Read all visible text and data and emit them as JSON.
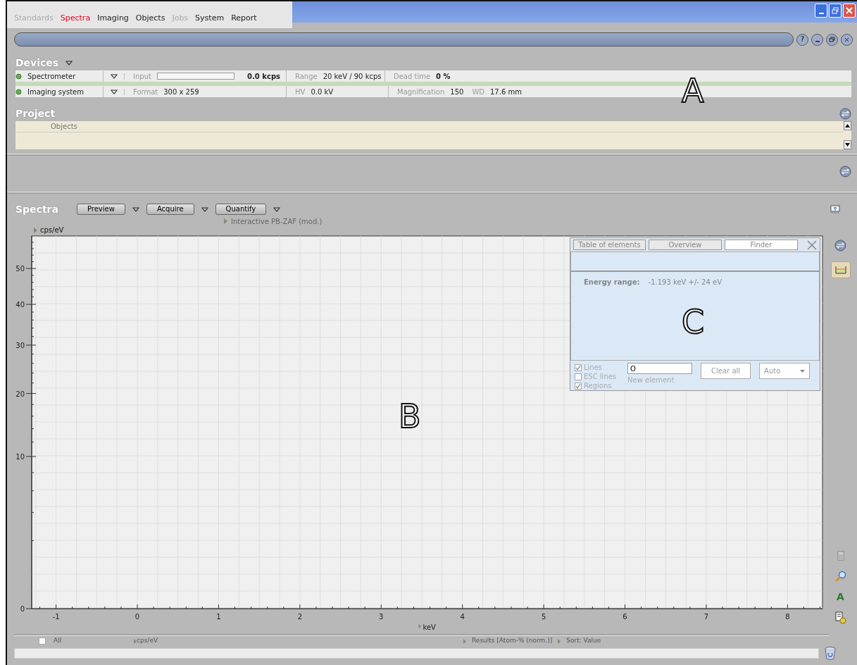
{
  "menu_tabs": [
    {
      "label": "Standards",
      "selected": false,
      "disabled": true
    },
    {
      "label": "Spectra",
      "selected": true,
      "disabled": false
    },
    {
      "label": "Imaging",
      "selected": false,
      "disabled": false
    },
    {
      "label": "Objects",
      "selected": false,
      "disabled": false
    },
    {
      "label": "Jobs",
      "selected": false,
      "disabled": true
    },
    {
      "label": "System",
      "selected": false,
      "disabled": false
    },
    {
      "label": "Report",
      "selected": false,
      "disabled": false
    }
  ],
  "panel_buttons": {
    "help": "?"
  },
  "devices": {
    "title": "Devices",
    "rows": [
      {
        "name": "Spectrometer",
        "fields": [
          {
            "kind": "meter",
            "label": "Input",
            "value": "0.0 kcps",
            "bold": true
          },
          {
            "kind": "text",
            "label": "Range",
            "value": "20 keV / 90 kcps",
            "bold": false
          },
          {
            "kind": "text",
            "label": "Dead time",
            "value": "0 %",
            "bold": true
          }
        ]
      },
      {
        "name": "Imaging system",
        "fields": [
          {
            "kind": "text",
            "label": "Format",
            "value": "300 x 259",
            "bold": false
          },
          {
            "kind": "text",
            "label": "HV",
            "value": "0.0 kV",
            "bold": false
          },
          {
            "kind": "text",
            "label": "Magnification",
            "value": "150",
            "bold": false
          },
          {
            "kind": "text",
            "label": "WD",
            "value": "17.6 mm",
            "bold": false
          }
        ]
      }
    ]
  },
  "project": {
    "title": "Project",
    "columns": [
      "Objects"
    ]
  },
  "spectra": {
    "title": "Spectra",
    "buttons": [
      "Preview",
      "Acquire",
      "Quantify"
    ],
    "method": "Interactive PB-ZAF (mod.)",
    "plot": {
      "xlabel": "keV",
      "ylabel": "cps/eV",
      "x_tick_labels": [
        "-1",
        "0",
        "1",
        "2",
        "3",
        "4",
        "5",
        "6",
        "7",
        "8"
      ],
      "y_tick_labels": [
        "50",
        "40",
        "30",
        "20",
        "10",
        "0"
      ]
    },
    "finder": {
      "tabs": [
        {
          "label": "Table of elements",
          "selected": false
        },
        {
          "label": "Overview",
          "selected": false
        },
        {
          "label": "Finder",
          "selected": true
        }
      ],
      "energy_label": "Energy range:",
      "energy_value": "-1.193 keV +/- 24 eV",
      "options": [
        {
          "label": "Lines",
          "checked": true
        },
        {
          "label": "ESC lines",
          "checked": false
        },
        {
          "label": "Regions",
          "checked": true
        }
      ],
      "element_value": "O",
      "element_caption": "New element",
      "clear_button": "Clear all",
      "mode": "Auto"
    }
  },
  "tools": {
    "text_tool": "A"
  },
  "results": {
    "all_label": "All",
    "all_checked": false,
    "unit": "cps/eV",
    "results": "Results [Atom-% (norm.)]",
    "sort": "Sort: Value"
  },
  "annotations": [
    "A",
    "B",
    "C"
  ]
}
